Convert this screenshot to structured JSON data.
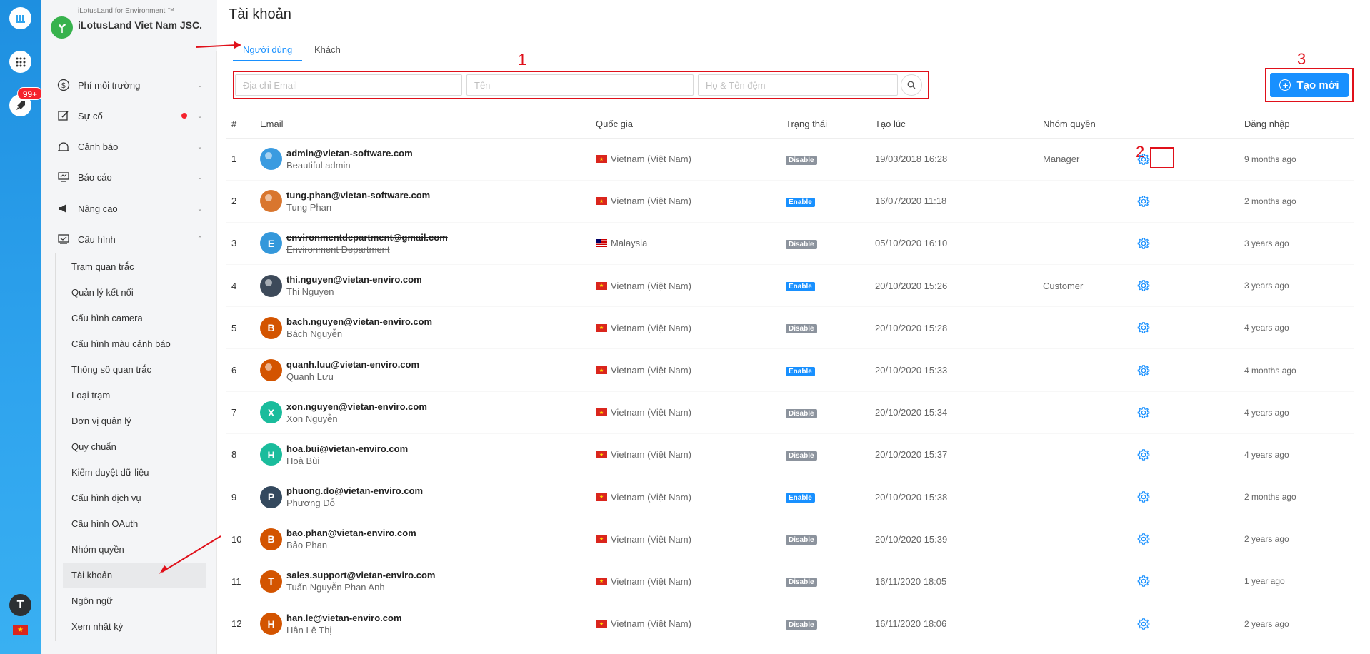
{
  "rail": {
    "notification_count": "99+",
    "user_initial": "T",
    "flag_star": "★"
  },
  "org": {
    "subtitle": "iLotusLand for Environment ™",
    "name": "iLotusLand Viet Nam JSC."
  },
  "menu": [
    {
      "label": "Phí môi trường",
      "icon": "dollar-icon"
    },
    {
      "label": "Sự cố",
      "icon": "edit-icon",
      "has_dot": true
    },
    {
      "label": "Cảnh báo",
      "icon": "alarm-icon"
    },
    {
      "label": "Báo cáo",
      "icon": "monitor-icon"
    },
    {
      "label": "Nâng cao",
      "icon": "megaphone-icon"
    },
    {
      "label": "Cấu hình",
      "icon": "config-icon",
      "expanded": true
    }
  ],
  "submenu": [
    "Trạm quan trắc",
    "Quản lý kết nối",
    "Cấu hình camera",
    "Cấu hình màu cảnh báo",
    "Thông số quan trắc",
    "Loại trạm",
    "Đơn vị quản lý",
    "Quy chuẩn",
    "Kiểm duyệt dữ liệu",
    "Cấu hình dịch vụ",
    "Cấu hình OAuth",
    "Nhóm quyền",
    "Tài khoản",
    "Ngôn ngữ",
    "Xem nhật ký"
  ],
  "page": {
    "title": "Tài khoản",
    "tabs": [
      "Người dùng",
      "Khách"
    ]
  },
  "search": {
    "email_placeholder": "Địa chỉ Email",
    "first_name_placeholder": "Tên",
    "last_name_placeholder": "Họ & Tên đệm"
  },
  "create_button": {
    "label": "Tạo mới"
  },
  "annotations": {
    "one": "1",
    "two": "2",
    "three": "3"
  },
  "table": {
    "headers": [
      "#",
      "Email",
      "Quốc gia",
      "Trạng thái",
      "Tạo lúc",
      "Nhóm quyền",
      "Đăng nhập"
    ],
    "rows": [
      {
        "no": "1",
        "email": "admin@vietan-software.com",
        "name": "Beautiful admin",
        "initial": "",
        "avatar_color": "#3a9be0",
        "country": "Vietnam (Việt Nam)",
        "flag": "vn",
        "status": "Disable",
        "created": "19/03/2018 16:28",
        "role": "Manager",
        "login": "9 months ago"
      },
      {
        "no": "2",
        "email": "tung.phan@vietan-software.com",
        "name": "Tung Phan",
        "initial": "",
        "avatar_color": "#d9762e",
        "country": "Vietnam (Việt Nam)",
        "flag": "vn",
        "status": "Enable",
        "created": "16/07/2020 11:18",
        "role": "",
        "login": "2 months ago"
      },
      {
        "no": "3",
        "email": "environmentdepartment@gmail.com",
        "name": "Environment Department",
        "initial": "E",
        "avatar_color": "#3498db",
        "country": "Malaysia",
        "flag": "my",
        "status": "Disable",
        "created": "05/10/2020 16:10",
        "role": "",
        "login": "3 years ago",
        "deleted": true
      },
      {
        "no": "4",
        "email": "thi.nguyen@vietan-enviro.com",
        "name": "Thi Nguyen",
        "initial": "",
        "avatar_color": "#3d4a5a",
        "country": "Vietnam (Việt Nam)",
        "flag": "vn",
        "status": "Enable",
        "created": "20/10/2020 15:26",
        "role": "Customer",
        "login": "3 years ago"
      },
      {
        "no": "5",
        "email": "bach.nguyen@vietan-enviro.com",
        "name": "Bách Nguyễn",
        "initial": "B",
        "avatar_color": "#d35400",
        "country": "Vietnam (Việt Nam)",
        "flag": "vn",
        "status": "Disable",
        "created": "20/10/2020 15:28",
        "role": "",
        "login": "4 years ago"
      },
      {
        "no": "6",
        "email": "quanh.luu@vietan-enviro.com",
        "name": "Quanh Lưu",
        "initial": "",
        "avatar_color": "#d35400",
        "country": "Vietnam (Việt Nam)",
        "flag": "vn",
        "status": "Enable",
        "created": "20/10/2020 15:33",
        "role": "",
        "login": "4 months ago"
      },
      {
        "no": "7",
        "email": "xon.nguyen@vietan-enviro.com",
        "name": "Xon Nguyễn",
        "initial": "X",
        "avatar_color": "#1abc9c",
        "country": "Vietnam (Việt Nam)",
        "flag": "vn",
        "status": "Disable",
        "created": "20/10/2020 15:34",
        "role": "",
        "login": "4 years ago"
      },
      {
        "no": "8",
        "email": "hoa.bui@vietan-enviro.com",
        "name": "Hoà Bùi",
        "initial": "H",
        "avatar_color": "#1abc9c",
        "country": "Vietnam (Việt Nam)",
        "flag": "vn",
        "status": "Disable",
        "created": "20/10/2020 15:37",
        "role": "",
        "login": "4 years ago"
      },
      {
        "no": "9",
        "email": "phuong.do@vietan-enviro.com",
        "name": "Phương Đỗ",
        "initial": "P",
        "avatar_color": "#34495e",
        "country": "Vietnam (Việt Nam)",
        "flag": "vn",
        "status": "Enable",
        "created": "20/10/2020 15:38",
        "role": "",
        "login": "2 months ago"
      },
      {
        "no": "10",
        "email": "bao.phan@vietan-enviro.com",
        "name": "Bảo Phan",
        "initial": "B",
        "avatar_color": "#d35400",
        "country": "Vietnam (Việt Nam)",
        "flag": "vn",
        "status": "Disable",
        "created": "20/10/2020 15:39",
        "role": "",
        "login": "2 years ago"
      },
      {
        "no": "11",
        "email": "sales.support@vietan-enviro.com",
        "name": "Tuấn Nguyễn Phan Anh",
        "initial": "T",
        "avatar_color": "#d35400",
        "country": "Vietnam (Việt Nam)",
        "flag": "vn",
        "status": "Disable",
        "created": "16/11/2020 18:05",
        "role": "",
        "login": "1 year ago"
      },
      {
        "no": "12",
        "email": "han.le@vietan-enviro.com",
        "name": "Hân Lê Thị",
        "initial": "H",
        "avatar_color": "#d35400",
        "country": "Vietnam (Việt Nam)",
        "flag": "vn",
        "status": "Disable",
        "created": "16/11/2020 18:06",
        "role": "",
        "login": "2 years ago"
      }
    ]
  },
  "colors": {
    "accent": "#1890ff",
    "annotation": "#e0101a",
    "rail": "#2fa4ee"
  }
}
